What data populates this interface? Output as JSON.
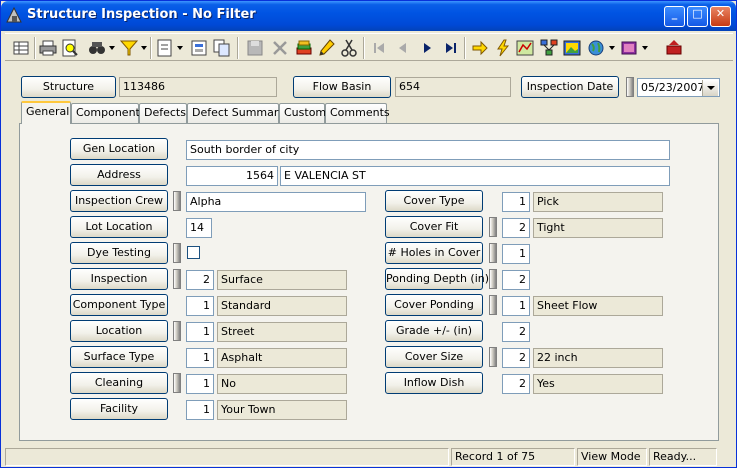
{
  "window": {
    "title": "Structure Inspection - No Filter",
    "minimize": "_",
    "maximize": "□",
    "close": "✕"
  },
  "toolbar": {
    "icons": [
      "grid-icon",
      "print-icon",
      "print-preview-icon",
      "binoculars-icon",
      "filter-icon",
      "form-icon",
      "properties-icon",
      "copy-icon",
      "save-icon",
      "delete-icon",
      "stack-icon",
      "pencil-icon",
      "cut-icon",
      "first-record-icon",
      "previous-record-icon",
      "next-record-icon",
      "last-record-icon",
      "arrow-right-icon",
      "lightning-icon",
      "map-icon",
      "network-icon",
      "image-icon",
      "globe-icon",
      "book-icon",
      "exit-icon"
    ]
  },
  "header": {
    "structure_label": "Structure",
    "structure_value": "113486",
    "flow_basin_label": "Flow Basin",
    "flow_basin_value": "654",
    "inspection_date_label": "Inspection Date",
    "inspection_date_value": "05/23/2007"
  },
  "tabs": [
    "General",
    "Components",
    "Defects",
    "Defect Summary",
    "Custom",
    "Comments"
  ],
  "form": {
    "gen_location_label": "Gen Location",
    "gen_location_value": "South border of city",
    "address_label": "Address",
    "address_number": "1564",
    "address_street": "E VALENCIA ST",
    "inspection_crew_label": "Inspection Crew",
    "inspection_crew_value": "Alpha",
    "lot_location_label": "Lot Location",
    "lot_location_value": "14",
    "dye_testing_label": "Dye Testing",
    "inspection_label": "Inspection",
    "inspection_code": "2",
    "inspection_desc": "Surface",
    "component_type_label": "Component Type",
    "component_type_code": "1",
    "component_type_desc": "Standard",
    "location_label": "Location",
    "location_code": "1",
    "location_desc": "Street",
    "surface_type_label": "Surface Type",
    "surface_type_code": "1",
    "surface_type_desc": "Asphalt",
    "cleaning_label": "Cleaning",
    "cleaning_code": "1",
    "cleaning_desc": "No",
    "facility_label": "Facility",
    "facility_code": "1",
    "facility_desc": "Your Town",
    "cover_type_label": "Cover Type",
    "cover_type_code": "1",
    "cover_type_desc": "Pick",
    "cover_fit_label": "Cover Fit",
    "cover_fit_code": "2",
    "cover_fit_desc": "Tight",
    "holes_label": "# Holes in Cover",
    "holes_value": "1",
    "ponding_depth_label": "Ponding Depth (in)",
    "ponding_depth_value": "2",
    "cover_ponding_label": "Cover Ponding",
    "cover_ponding_code": "1",
    "cover_ponding_desc": "Sheet Flow",
    "grade_label": "Grade +/- (in)",
    "grade_value": "2",
    "cover_size_label": "Cover Size",
    "cover_size_code": "2",
    "cover_size_desc": "22 inch",
    "inflow_dish_label": "Inflow Dish",
    "inflow_dish_code": "2",
    "inflow_dish_desc": "Yes"
  },
  "status": {
    "record": "Record 1 of 75",
    "mode": "View Mode",
    "state": "Ready..."
  }
}
